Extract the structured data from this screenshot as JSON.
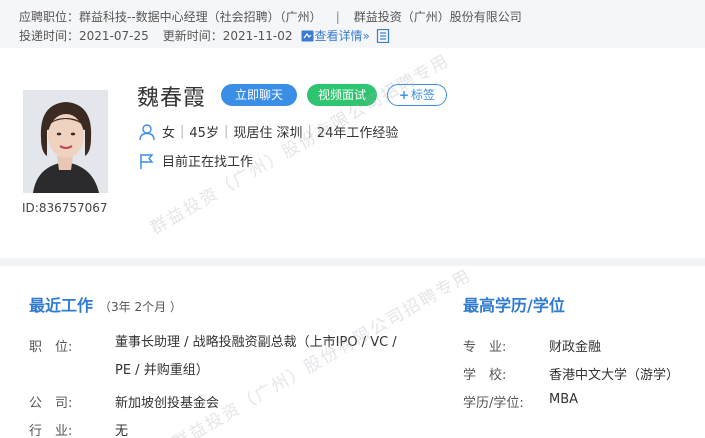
{
  "header": {
    "job_label": "应聘职位：",
    "job_title": "群益科技--数据中心经理（社会招聘）（广州）",
    "separator": "|",
    "company": "群益投资（广州）股份有限公司",
    "apply_time_label": "投递时间：",
    "apply_time": "2021-07-25",
    "update_time_label": "更新时间：",
    "update_time": "2021-11-02",
    "detail_link": "查看详情",
    "detail_arrow": "»"
  },
  "profile": {
    "name": "魏春霞",
    "chat_button": "立即聊天",
    "video_button": "视频面试",
    "tag_button": "标签",
    "tag_plus": "+",
    "gender": "女",
    "age": "45岁",
    "residence": "现居住 深圳",
    "experience": "24年工作经验",
    "job_status": "目前正在找工作",
    "id_label": "ID:836757067",
    "meta_separator": "|"
  },
  "work": {
    "title": "最近工作",
    "duration": "（3年 2个月 ）",
    "position_label": "职　位:",
    "position": "董事长助理 / 战略投融资副总裁（上市IPO / VC / PE / 并购重组）",
    "company_label": "公　司:",
    "company": "新加坡创投基金会",
    "industry_label": "行　业:",
    "industry": "无"
  },
  "education": {
    "title": "最高学历/学位",
    "major_label": "专　业:",
    "major": "财政金融",
    "school_label": "学　校:",
    "school": "香港中文大学（游学）",
    "degree_label": "学历/学位:",
    "degree": "MBA"
  },
  "watermark": {
    "text": "群益投资（广州）股份有限公司招聘专用"
  },
  "icons": {
    "person": "person-icon",
    "flag": "flag-icon",
    "detail": "detail-icon",
    "doc": "document-icon"
  },
  "colors": {
    "accent": "#3a8ee6",
    "section_title": "#2f7bd0",
    "video_button": "#2fc470",
    "link": "#3a7bd5",
    "top_band": "#f5f6f8"
  }
}
